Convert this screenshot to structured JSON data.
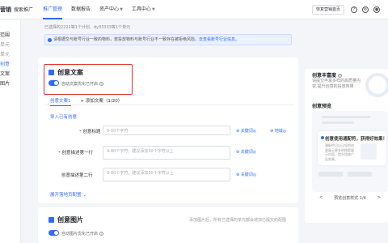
{
  "header": {
    "logo": "营销",
    "logo_sub": "搜索推广",
    "nav": [
      {
        "label": "推广管理",
        "active": true
      },
      {
        "label": "数据报告",
        "active": false
      },
      {
        "label": "资产中心",
        "active": false,
        "dropdown": true
      },
      {
        "label": "工具中心",
        "active": false,
        "dropdown": true
      }
    ],
    "restore_button": "恢复营销首页"
  },
  "sidebar": {
    "items": [
      {
        "label": "范围",
        "state": "normal"
      },
      {
        "label": "单元",
        "state": "dim"
      },
      {
        "label": "单元",
        "state": "dim"
      },
      {
        "label": "创意",
        "state": "active"
      },
      {
        "label": "文案",
        "state": "normal"
      },
      {
        "label": "图片",
        "state": "normal"
      }
    ]
  },
  "info_line": "已选择的2222等1个计划、dy33333等1个单元",
  "notice": {
    "text": "请根据交与账号行业一致的物料，若投放物料与账号行业不一致存在被拒绝风险。",
    "link": "去查看账号行业信息。"
  },
  "creative_text": {
    "title": "创意文案",
    "toggle_label": "自动文案优化已开启",
    "tabs": [
      {
        "label": "创意文案1",
        "active": true
      },
      {
        "label": "+ 添加文案（1/20）",
        "active": false
      }
    ],
    "import_link": "导入已有创意",
    "fields": [
      {
        "label": "创意标题",
        "required": true,
        "placeholder": "9-50个字符"
      },
      {
        "label": "创意描述第一行",
        "required": true,
        "placeholder": "9-80个字符，建议添加30个字符以上"
      },
      {
        "label": "创意描述第二行",
        "required": false,
        "placeholder": "9-80个字符，建议添加30个字符以上"
      }
    ],
    "keyword_link": "关键词",
    "region_link": "地域",
    "expand_link": "展开落地页配置"
  },
  "creative_image": {
    "title": "创意图片",
    "toggle_label": "自动图片优化已开启",
    "hint": "添加图片后，所有已选择的单元都会增加已提交的配图"
  },
  "right_panel": {
    "richness_title": "创意丰富度",
    "richness_text": "请提交丰富多样的高质量内容,提升创意的投放效果",
    "preview_title": "创意预览",
    "tip_title": "创意使用通配符，获得好效果！",
    "tip_text": "通配符可以让您的创意展示更多的搜索展示内容，提升投放广告效果。",
    "footer_left": "<",
    "footer_center": "预览创意样式 1/4",
    "footer_right": ">"
  },
  "colors": {
    "accent": "#2f6bff",
    "highlight": "#e0352b",
    "required": "#e0352b"
  }
}
